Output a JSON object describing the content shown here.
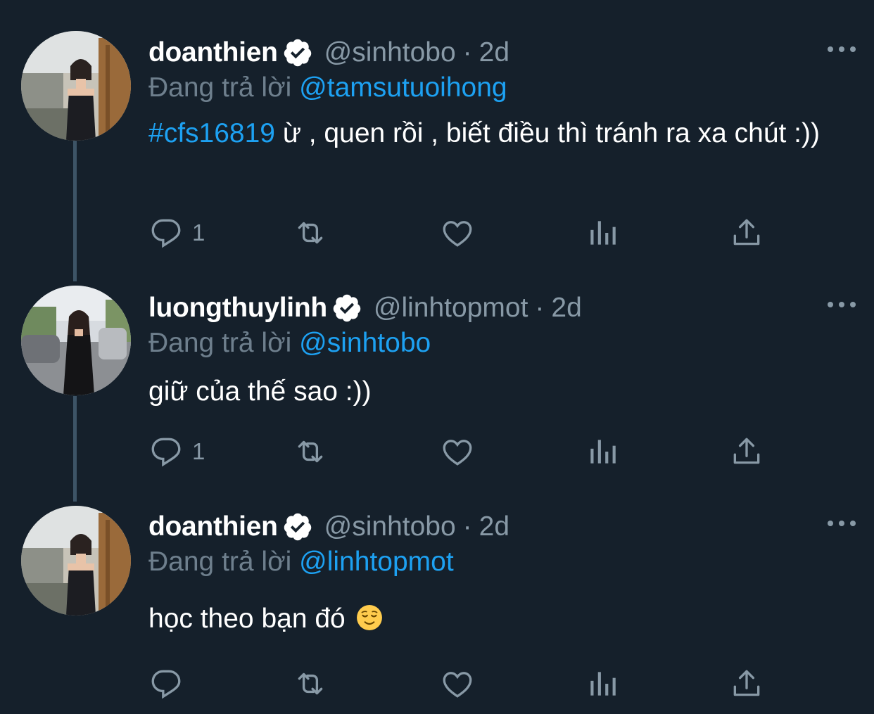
{
  "tweets": [
    {
      "display_name": "doanthien",
      "handle": "@sinhtobo",
      "separator": "·",
      "time": "2d",
      "reply_prefix": "Đang trả lời",
      "reply_to": "@tamsutuoihong",
      "hashtag": "#cfs16819",
      "text": " ừ , quen rồi , biết điều thì tránh ra xa chút :))",
      "reply_count": "1",
      "avatar": "avatar-woman-black-dress"
    },
    {
      "display_name": "luongthuylinh",
      "handle": "@linhtopmot",
      "separator": "·",
      "time": "2d",
      "reply_prefix": "Đang trả lời",
      "reply_to": "@sinhtobo",
      "text": "giữ của thế sao :))",
      "reply_count": "1",
      "avatar": "avatar-woman-street"
    },
    {
      "display_name": "doanthien",
      "handle": "@sinhtobo",
      "separator": "·",
      "time": "2d",
      "reply_prefix": "Đang trả lời",
      "reply_to": "@linhtopmot",
      "text": "học theo bạn đó ",
      "emoji": "relieved-face-emoji",
      "reply_count": "",
      "avatar": "avatar-woman-black-dress"
    }
  ],
  "icons": {
    "verified": "verified-badge-icon",
    "more": "more-dots-icon",
    "reply": "reply-icon",
    "retweet": "retweet-icon",
    "like": "like-icon",
    "analytics": "analytics-icon",
    "share": "share-icon"
  },
  "colors": {
    "background": "#15202b",
    "link": "#1da1f2",
    "secondary_text": "#8899a6",
    "thread_line": "#3d5466"
  }
}
